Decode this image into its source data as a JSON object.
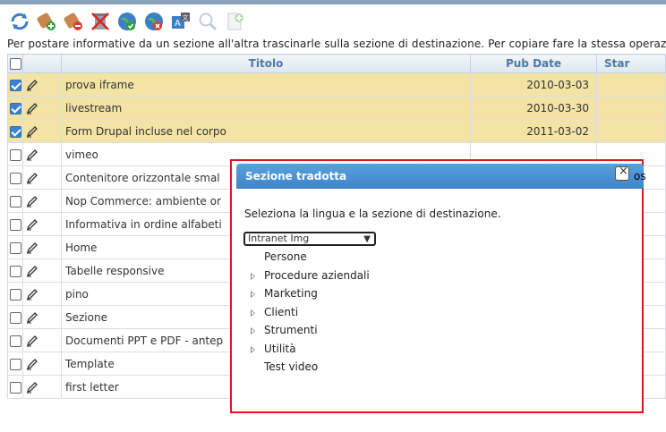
{
  "toolbar": {
    "icons": [
      "refresh-icon",
      "add-item-icon",
      "remove-item-icon",
      "delete-icon",
      "publish-icon",
      "unpublish-icon",
      "translate-icon",
      "search-icon",
      "new-document-icon"
    ]
  },
  "instructions": "Per postare informative da un sezione all'altra trascinarle sulla sezione di destinazione. Per copiare fare la stessa operazi",
  "table": {
    "headers": {
      "titolo": "Titolo",
      "pub_date": "Pub Date",
      "stato": "Star"
    },
    "rows": [
      {
        "title": "prova iframe",
        "date": "2010-03-03",
        "checked": true
      },
      {
        "title": "livestream",
        "date": "2010-03-30",
        "checked": true
      },
      {
        "title": "Form Drupal incluse nel corpo",
        "date": "2011-03-02",
        "checked": true
      },
      {
        "title": "vimeo",
        "date": "",
        "checked": false
      },
      {
        "title": "Contenitore orizzontale smal",
        "date": "",
        "checked": false
      },
      {
        "title": "Nop Commerce: ambiente or",
        "date": "",
        "checked": false
      },
      {
        "title": "Informativa in ordine alfabeti",
        "date": "",
        "checked": false
      },
      {
        "title": "Home",
        "date": "",
        "checked": false
      },
      {
        "title": "Tabelle responsive",
        "date": "",
        "checked": false
      },
      {
        "title": "pino",
        "date": "",
        "checked": false
      },
      {
        "title": "Sezione",
        "date": "",
        "checked": false
      },
      {
        "title": "Documenti PPT e PDF - antep",
        "date": "",
        "checked": false
      },
      {
        "title": "Template",
        "date": "",
        "checked": false
      },
      {
        "title": "first letter",
        "date": "",
        "checked": false
      }
    ]
  },
  "dialog": {
    "title": "Sezione tradotta",
    "close_spill": "os",
    "message": "Seleziona la lingua e la sezione di destinazione.",
    "selected_language": "Intranet Img",
    "tree": [
      {
        "label": "Persone",
        "expandable": false
      },
      {
        "label": "Procedure aziendali",
        "expandable": true
      },
      {
        "label": "Marketing",
        "expandable": true
      },
      {
        "label": "Clienti",
        "expandable": true
      },
      {
        "label": "Strumenti",
        "expandable": true
      },
      {
        "label": "Utilità",
        "expandable": true
      },
      {
        "label": "Test video",
        "expandable": false
      }
    ]
  },
  "colors": {
    "selected_row": "#f3e3a5",
    "dialog_header": "#4a90d9",
    "highlight_border": "#e0161f",
    "header_text": "#4d7aa6"
  }
}
